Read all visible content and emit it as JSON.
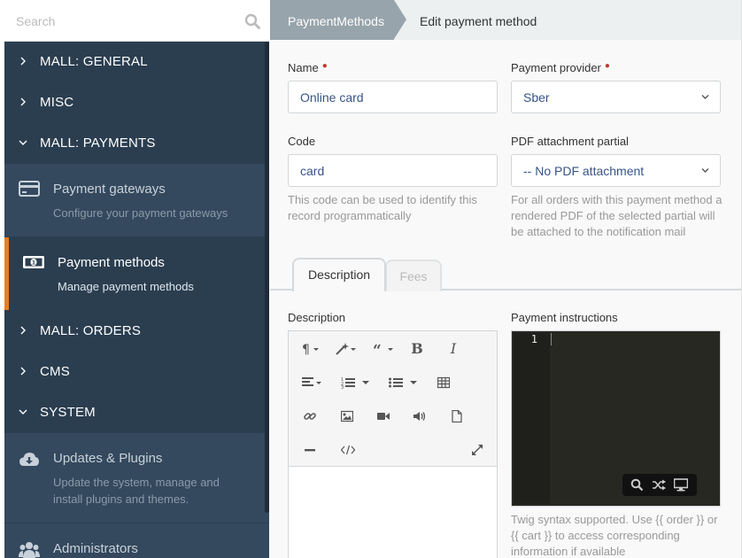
{
  "search": {
    "placeholder": "Search"
  },
  "sidebar": {
    "groups": [
      {
        "label": "MALL: GENERAL",
        "expanded": false
      },
      {
        "label": "MISC",
        "expanded": false
      },
      {
        "label": "MALL: PAYMENTS",
        "expanded": true
      },
      {
        "label": "MALL: ORDERS",
        "expanded": false
      },
      {
        "label": "CMS",
        "expanded": false
      },
      {
        "label": "SYSTEM",
        "expanded": true
      }
    ],
    "items": [
      {
        "title": "Payment gateways",
        "desc": "Configure your payment gateways",
        "icon": "credit-card-icon",
        "active": false
      },
      {
        "title": "Payment methods",
        "desc": "Manage payment methods",
        "icon": "money-icon",
        "active": true
      },
      {
        "title": "Updates & Plugins",
        "desc": "Update the system, manage and install plugins and themes.",
        "icon": "cloud-download-icon",
        "active": false
      },
      {
        "title": "Administrators",
        "desc": "",
        "icon": "users-icon",
        "active": false
      }
    ]
  },
  "breadcrumb": {
    "parent": "PaymentMethods",
    "current": "Edit payment method"
  },
  "form": {
    "name": {
      "label": "Name",
      "value": "Online card",
      "required": true
    },
    "provider": {
      "label": "Payment provider",
      "value": "Sber",
      "required": true
    },
    "code": {
      "label": "Code",
      "value": "card",
      "help": "This code can be used to identify this record programmatically"
    },
    "pdf": {
      "label": "PDF attachment partial",
      "value": "-- No PDF attachment",
      "help": "For all orders with this payment method a rendered PDF of the selected partial will be attached to the notification mail"
    }
  },
  "tabs": [
    {
      "label": "Description",
      "active": true
    },
    {
      "label": "Fees",
      "active": false
    }
  ],
  "description": {
    "label": "Description"
  },
  "instructions": {
    "label": "Payment instructions",
    "line_number": "1",
    "help": "Twig syntax supported. Use {{ order }} or {{ cart }} to access corresponding information if available"
  },
  "colors": {
    "sidebar_bg": "#2b3e50",
    "accent": "#e67e22",
    "required": "#c0392b",
    "breadcrumb": "#97a4ab"
  }
}
